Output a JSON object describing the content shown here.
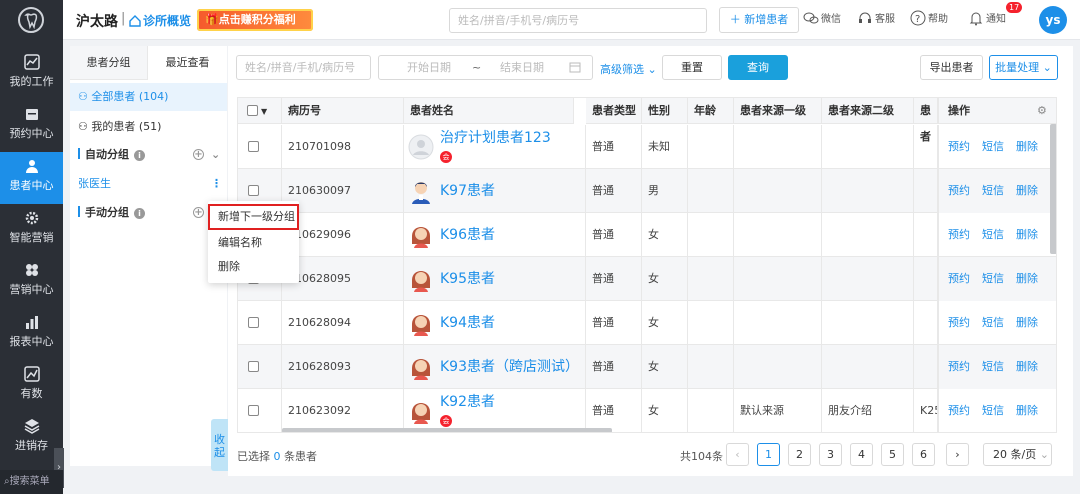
{
  "nav": {
    "items": [
      {
        "label": "我的工作",
        "icon": "chart-icon"
      },
      {
        "label": "预约中心",
        "icon": "calendar-icon"
      },
      {
        "label": "患者中心",
        "icon": "user-icon",
        "active": true
      },
      {
        "label": "智能营销",
        "icon": "gear-icon"
      },
      {
        "label": "营销中心",
        "icon": "clover-icon"
      },
      {
        "label": "报表中心",
        "icon": "bar-chart-icon"
      },
      {
        "label": "有数",
        "icon": "trend-icon"
      },
      {
        "label": "进销存",
        "icon": "layers-icon"
      }
    ],
    "search": "搜索菜单"
  },
  "topbar": {
    "clinic": "沪太路",
    "sep": "|",
    "overview": "诊所概览",
    "promo": "点击赚积分福利",
    "search_placeholder": "姓名/拼音/手机号/病历号",
    "new_patient": "新增患者",
    "wechat": "微信",
    "service": "客服",
    "help": "帮助",
    "notify": "通知",
    "notify_count": "17",
    "avatar": "ys"
  },
  "groups": {
    "tabs": [
      "患者分组",
      "最近查看"
    ],
    "all": "全部患者",
    "all_count": "(104)",
    "mine": "我的患者",
    "mine_count": "(51)",
    "auto": "自动分组",
    "doctor": "张医生",
    "manual": "手动分组",
    "collapse": "收起"
  },
  "context_menu": [
    "新增下一级分组",
    "编辑名称",
    "删除"
  ],
  "filters": {
    "name_placeholder": "姓名/拼音/手机/病历号",
    "start": "开始日期",
    "tilde": "~",
    "end": "结束日期",
    "advanced": "高级筛选",
    "reset": "重置",
    "query": "查询",
    "export": "导出患者",
    "batch": "批量处理"
  },
  "table": {
    "columns": [
      "病历号",
      "患者姓名",
      "患者类型",
      "性别",
      "年龄",
      "患者来源一级",
      "患者来源二级",
      "患者",
      "操作"
    ],
    "ops": [
      "预约",
      "短信",
      "删除"
    ],
    "rows": [
      {
        "id": "210701098",
        "name": "治疗计划患者123",
        "type": "普通",
        "gender": "未知",
        "age": "",
        "src1": "",
        "src2": "",
        "src3": "",
        "avatar": "default",
        "tag": "会"
      },
      {
        "id": "210630097",
        "name": "K97患者",
        "type": "普通",
        "gender": "男",
        "age": "",
        "src1": "",
        "src2": "",
        "src3": "",
        "avatar": "male",
        "tag": ""
      },
      {
        "id": "210629096",
        "name": "K96患者",
        "type": "普通",
        "gender": "女",
        "age": "",
        "src1": "",
        "src2": "",
        "src3": "",
        "avatar": "female",
        "tag": ""
      },
      {
        "id": "210628095",
        "name": "K95患者",
        "type": "普通",
        "gender": "女",
        "age": "",
        "src1": "",
        "src2": "",
        "src3": "",
        "avatar": "female",
        "tag": ""
      },
      {
        "id": "210628094",
        "name": "K94患者",
        "type": "普通",
        "gender": "女",
        "age": "",
        "src1": "",
        "src2": "",
        "src3": "",
        "avatar": "female",
        "tag": ""
      },
      {
        "id": "210628093",
        "name": "K93患者（跨店测试）",
        "type": "普通",
        "gender": "女",
        "age": "",
        "src1": "",
        "src2": "",
        "src3": "",
        "avatar": "female",
        "tag": ""
      },
      {
        "id": "210623092",
        "name": "K92患者",
        "type": "普通",
        "gender": "女",
        "age": "",
        "src1": "默认来源",
        "src2": "朋友介绍",
        "src3": "K25",
        "avatar": "female",
        "tag": "会"
      }
    ]
  },
  "footer": {
    "selected_prefix": "已选择",
    "selected_count": "0",
    "selected_suffix": "条患者",
    "total": "共104条",
    "pages": [
      "1",
      "2",
      "3",
      "4",
      "5",
      "6"
    ],
    "current_page": "1",
    "page_size": "20 条/页"
  }
}
